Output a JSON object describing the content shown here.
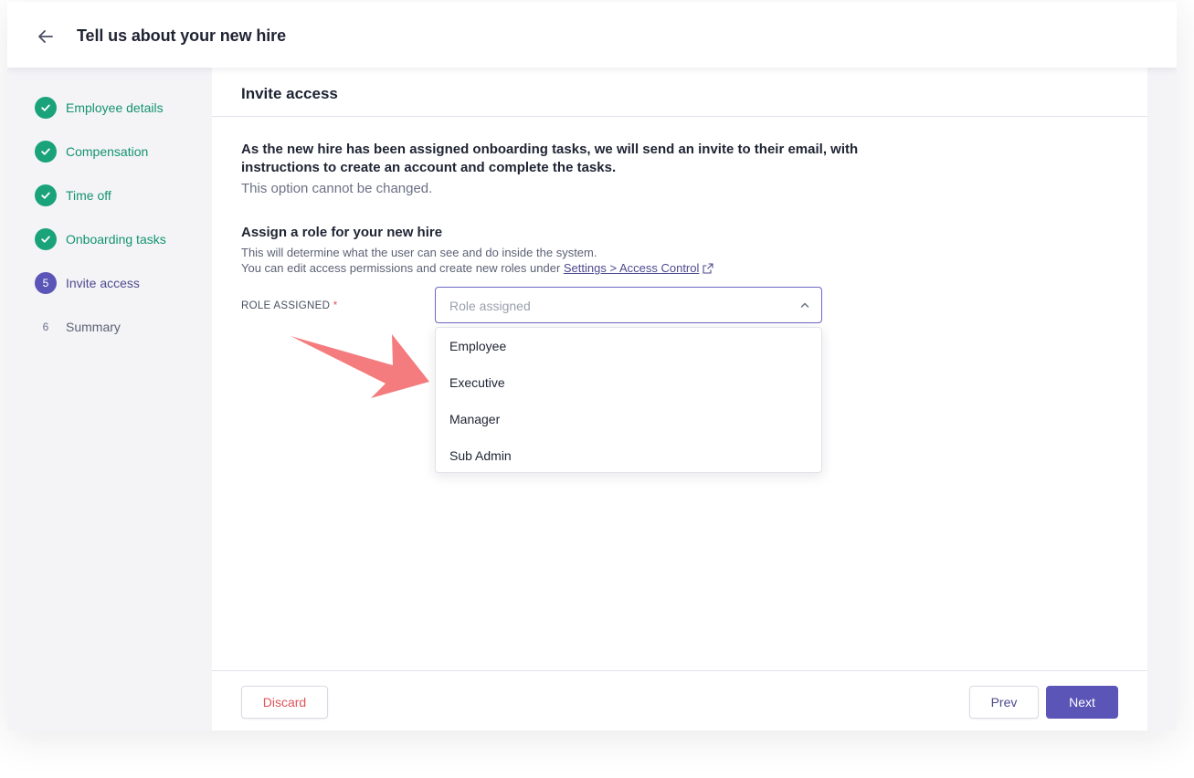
{
  "header": {
    "title": "Tell us about your new hire"
  },
  "steps": [
    {
      "label": "Employee details",
      "status": "done",
      "number": ""
    },
    {
      "label": "Compensation",
      "status": "done",
      "number": ""
    },
    {
      "label": "Time off",
      "status": "done",
      "number": ""
    },
    {
      "label": "Onboarding tasks",
      "status": "done",
      "number": ""
    },
    {
      "label": "Invite access",
      "status": "active",
      "number": "5"
    },
    {
      "label": "Summary",
      "status": "todo",
      "number": "6"
    }
  ],
  "panel": {
    "title": "Invite access",
    "notice_main": "As the new hire has been assigned onboarding tasks, we will send an invite to their email, with instructions to create an account and complete the tasks.",
    "notice_sub": "This option cannot be changed.",
    "assign_title": "Assign a role for your new hire",
    "assign_desc_line1": "This will determine what the user can see and do inside the system.",
    "assign_desc_line2": "You can edit access permissions and create new roles under ",
    "settings_link": "Settings > Access Control"
  },
  "role_field": {
    "label": "ROLE ASSIGNED",
    "required_mark": "*",
    "placeholder": "Role assigned",
    "options": [
      "Employee",
      "Executive",
      "Manager",
      "Sub Admin"
    ]
  },
  "footer": {
    "discard": "Discard",
    "prev": "Prev",
    "next": "Next"
  },
  "colors": {
    "accent": "#5b55b8",
    "success": "#1aa37a",
    "danger": "#e0545a",
    "annotation_arrow": "#f47b7e"
  },
  "icons": {
    "back": "arrow-left-icon",
    "done": "check-icon",
    "external": "external-link-icon",
    "dropdown": "chevron-up-icon",
    "annotation": "pointer-arrow-icon"
  }
}
